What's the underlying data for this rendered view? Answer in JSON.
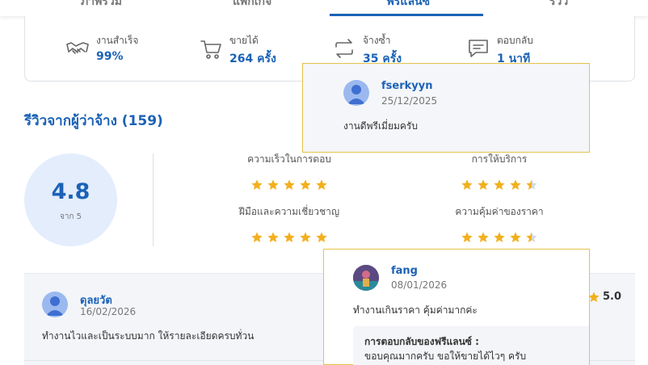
{
  "tabs": [
    "ภาพรวม",
    "แพ็กเกจ",
    "ฟรีแลนซ์",
    "รีวิว"
  ],
  "stats": [
    {
      "label": "งานสำเร็จ",
      "value": "99%",
      "icon": "handshake-icon"
    },
    {
      "label": "ขายได้",
      "value": "264 ครั้ง",
      "icon": "cart-icon"
    },
    {
      "label": "จ้างซ้ำ",
      "value": "35 ครั้ง",
      "icon": "repeat-icon"
    },
    {
      "label": "ตอบกลับ",
      "value": "1 นาที",
      "icon": "message-icon"
    }
  ],
  "reviews_title": "รีวิวจากผู้ว่าจ้าง (159)",
  "rating": {
    "score": "4.8",
    "sub": "จาก 5",
    "criteria": [
      {
        "label": "ความเร็วในการตอบ",
        "stars": 5
      },
      {
        "label": "การให้บริการ",
        "stars": 4.5
      },
      {
        "label": "ฝีมือและความเชี่ยวชาญ",
        "stars": 5
      },
      {
        "label": "ความคุ้มค่าของราคา",
        "stars": 4.5
      }
    ]
  },
  "review": {
    "name": "ดุลยวัต",
    "date": "16/02/2026",
    "text": "ทำงานไวและเป็นระบบมาก ให้รายละเอียดครบทั่วน",
    "score": "5.0"
  },
  "popup1": {
    "name": "fserkyyn",
    "date": "25/12/2025",
    "text": "งานดีพรีเมี่ยมครับ"
  },
  "popup2": {
    "name": "fang",
    "date": "08/01/2026",
    "text": "ทำงานเกินราคา คุ้มค่ามากค่ะ",
    "reply_title": "การตอบกลับของฟรีแลนซ์ :",
    "reply_text": "ขอบคุณมากครับ ขอให้ขายได้ไวๆ ครับ"
  },
  "colors": {
    "accent": "#1b62b6",
    "star": "#f2b01e",
    "star_empty": "#d7d9dd",
    "popup_border": "#e6c34a"
  }
}
